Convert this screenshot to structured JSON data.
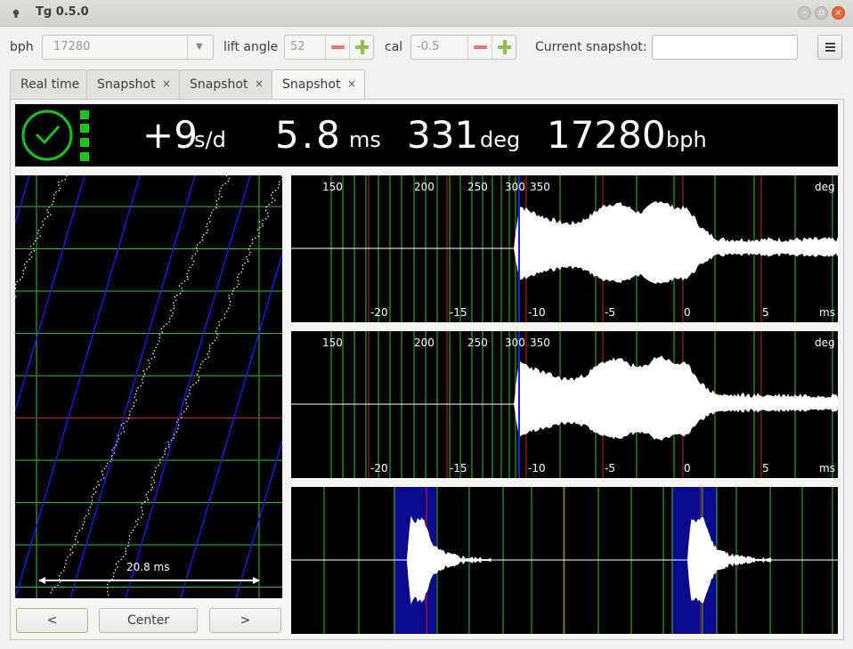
{
  "window": {
    "title": "Tg 0.5.0"
  },
  "toolbar": {
    "bph_label": "bph",
    "bph_value": "17280",
    "lift_angle_label": "lift angle",
    "lift_angle_value": "52",
    "cal_label": "cal",
    "cal_value": "-0.5",
    "snapshot_label": "Current snapshot:",
    "snapshot_value": ""
  },
  "tabs": [
    {
      "label": "Real time",
      "closable": false,
      "active": false
    },
    {
      "label": "Snapshot",
      "closable": true,
      "active": false
    },
    {
      "label": "Snapshot",
      "closable": true,
      "active": false
    },
    {
      "label": "Snapshot",
      "closable": true,
      "active": true
    }
  ],
  "close_glyph": "×",
  "readout": {
    "rate_value": "+9",
    "rate_unit": "s/d",
    "beat_error_value": "5.8",
    "beat_error_unit": "ms",
    "amplitude_value": "331",
    "amplitude_unit": "deg",
    "bph_value": "17280",
    "bph_unit": "bph",
    "status_color": "#18c418"
  },
  "paperstrip": {
    "span_label": "20.8 ms"
  },
  "tic_plot": {
    "deg_ticks": [
      "150",
      "200",
      "250",
      "300",
      "350"
    ],
    "deg_unit": "deg",
    "ms_ticks": [
      "-20",
      "-15",
      "-10",
      "-5",
      "0",
      "5"
    ],
    "ms_unit": "ms"
  },
  "toc_plot": {
    "deg_ticks": [
      "150",
      "200",
      "250",
      "300",
      "350"
    ],
    "deg_unit": "deg",
    "ms_ticks": [
      "-20",
      "-15",
      "-10",
      "-5",
      "0",
      "5"
    ],
    "ms_unit": "ms"
  },
  "buttons": {
    "prev": "<",
    "center": "Center",
    "next": ">"
  },
  "colors": {
    "grid_green": "#2ec22e",
    "grid_red": "#d02020",
    "trace_blue": "#1a1aff",
    "waveform": "#ffffff",
    "highlight": "#0a0a8c"
  }
}
